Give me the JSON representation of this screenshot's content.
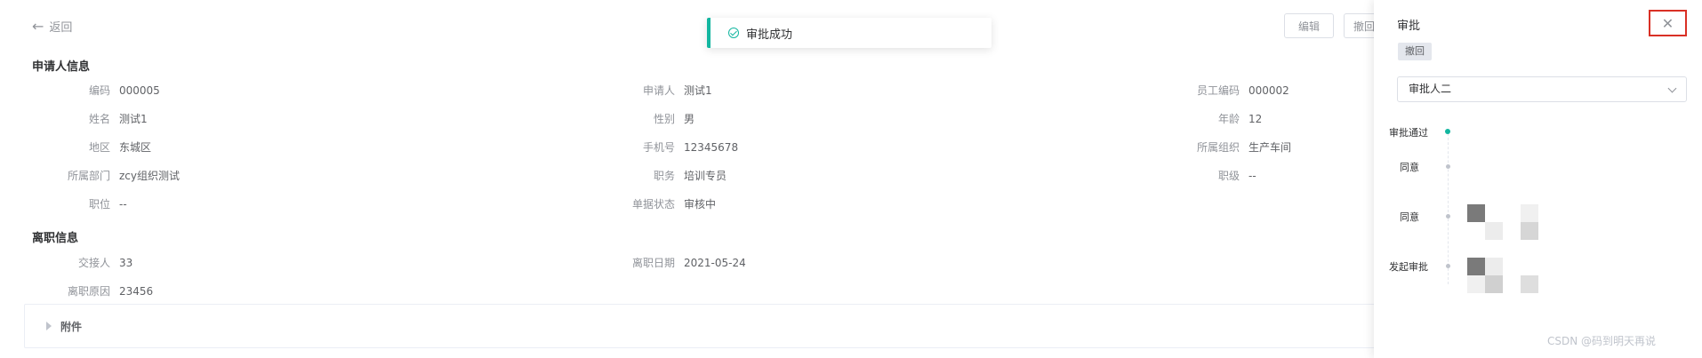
{
  "header": {
    "back_label": "返回",
    "buttons": {
      "edit": "编辑",
      "withdraw": "撤回"
    }
  },
  "toast": {
    "message": "审批成功"
  },
  "applicant_section": {
    "title": "申请人信息",
    "fields": {
      "code": {
        "label": "编码",
        "value": "000005"
      },
      "applicant": {
        "label": "申请人",
        "value": "测试1"
      },
      "employee_code": {
        "label": "员工编码",
        "value": "000002"
      },
      "name": {
        "label": "姓名",
        "value": "测试1"
      },
      "gender": {
        "label": "性别",
        "value": "男"
      },
      "age": {
        "label": "年龄",
        "value": "12"
      },
      "region": {
        "label": "地区",
        "value": "东城区"
      },
      "phone": {
        "label": "手机号",
        "value": "12345678"
      },
      "org": {
        "label": "所属组织",
        "value": "生产车间"
      },
      "dept": {
        "label": "所属部门",
        "value": "zcy组织测试"
      },
      "job": {
        "label": "职务",
        "value": "培训专员"
      },
      "level": {
        "label": "职级",
        "value": "--"
      },
      "position": {
        "label": "职位",
        "value": "--"
      },
      "doc_status": {
        "label": "单据状态",
        "value": "审核中"
      }
    }
  },
  "resign_section": {
    "title": "离职信息",
    "fields": {
      "handover": {
        "label": "交接人",
        "value": "33"
      },
      "resign_date": {
        "label": "离职日期",
        "value": "2021-05-24"
      },
      "reason": {
        "label": "离职原因",
        "value": "23456"
      }
    }
  },
  "attachments": {
    "label": "附件"
  },
  "drawer": {
    "title": "审批",
    "withdraw_tag": "撤回",
    "approver_select": {
      "value": "审批人二"
    },
    "timeline": {
      "status": "审批通过",
      "items": [
        "同意",
        "同意",
        "发起审批"
      ]
    },
    "close_icon": "close-icon"
  },
  "watermark": "CSDN @码到明天再说"
}
